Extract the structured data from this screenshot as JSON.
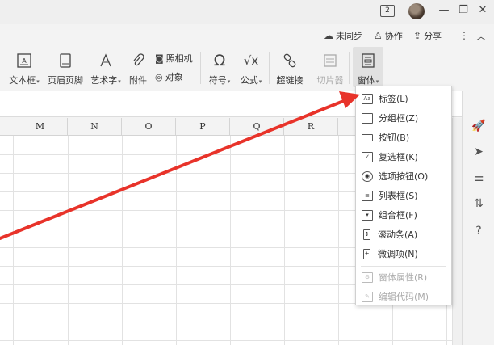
{
  "titlebar": {
    "badge": "2",
    "minimize_icon": "minimize-icon",
    "restore_icon": "restore-icon",
    "close_icon": "close-icon"
  },
  "command_bar": {
    "unsync": "未同步",
    "collab": "协作",
    "share": "分享",
    "more_icon": "more-icon",
    "collapse_icon": "chevron-up-icon"
  },
  "ribbon": {
    "textbox": "文本框",
    "header_footer": "页眉页脚",
    "wordart": "艺术字",
    "attachment": "附件",
    "camera": "照相机",
    "object": "对象",
    "symbol": "符号",
    "formula": "公式",
    "hyperlink": "超链接",
    "slicer": "切片器",
    "form": "窗体"
  },
  "sheet": {
    "columns": [
      "M",
      "N",
      "O",
      "P",
      "Q",
      "R"
    ]
  },
  "menu": {
    "items": [
      {
        "label": "标签(L)",
        "icon": "Aa",
        "enabled": true
      },
      {
        "label": "分组框(Z)",
        "icon": "",
        "enabled": true
      },
      {
        "label": "按钮(B)",
        "icon": "",
        "enabled": true
      },
      {
        "label": "复选框(K)",
        "icon": "✓",
        "enabled": true
      },
      {
        "label": "选项按钮(O)",
        "icon": "◉",
        "enabled": true
      },
      {
        "label": "列表框(S)",
        "icon": "≡",
        "enabled": true
      },
      {
        "label": "组合框(F)",
        "icon": "▾",
        "enabled": true
      },
      {
        "label": "滚动条(A)",
        "icon": "↕",
        "enabled": true
      },
      {
        "label": "微调项(N)",
        "icon": "±",
        "enabled": true
      },
      {
        "label": "窗体属性(R)",
        "icon": "⚙",
        "enabled": false
      },
      {
        "label": "编辑代码(M)",
        "icon": "✎",
        "enabled": false
      }
    ]
  },
  "colors": {
    "arrow": "#e8332a",
    "menu_border": "#d0d0d0",
    "grid": "#e2e2e2"
  }
}
